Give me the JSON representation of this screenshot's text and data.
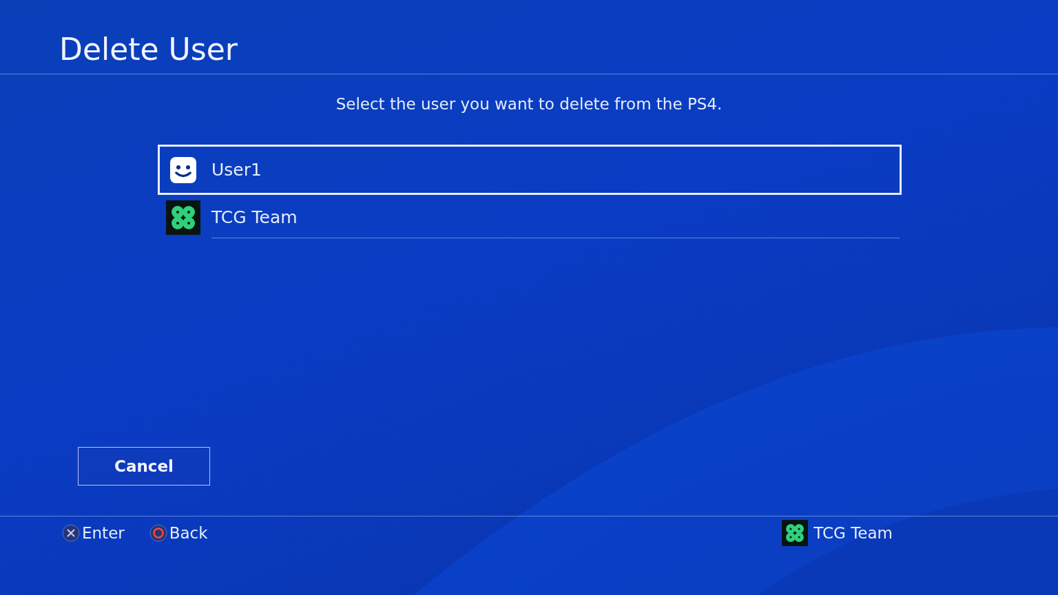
{
  "title": "Delete User",
  "instruction": "Select the user you want to delete from the PS4.",
  "users": [
    {
      "name": "User1",
      "kind": "smiley",
      "selected": true
    },
    {
      "name": "TCG Team",
      "kind": "clover",
      "selected": false
    }
  ],
  "cancel_button": "Cancel",
  "hints": [
    {
      "kind": "cross",
      "label": "Enter"
    },
    {
      "kind": "circle",
      "label": "Back"
    }
  ],
  "current_user": {
    "name": "TCG Team",
    "kind": "clover"
  }
}
